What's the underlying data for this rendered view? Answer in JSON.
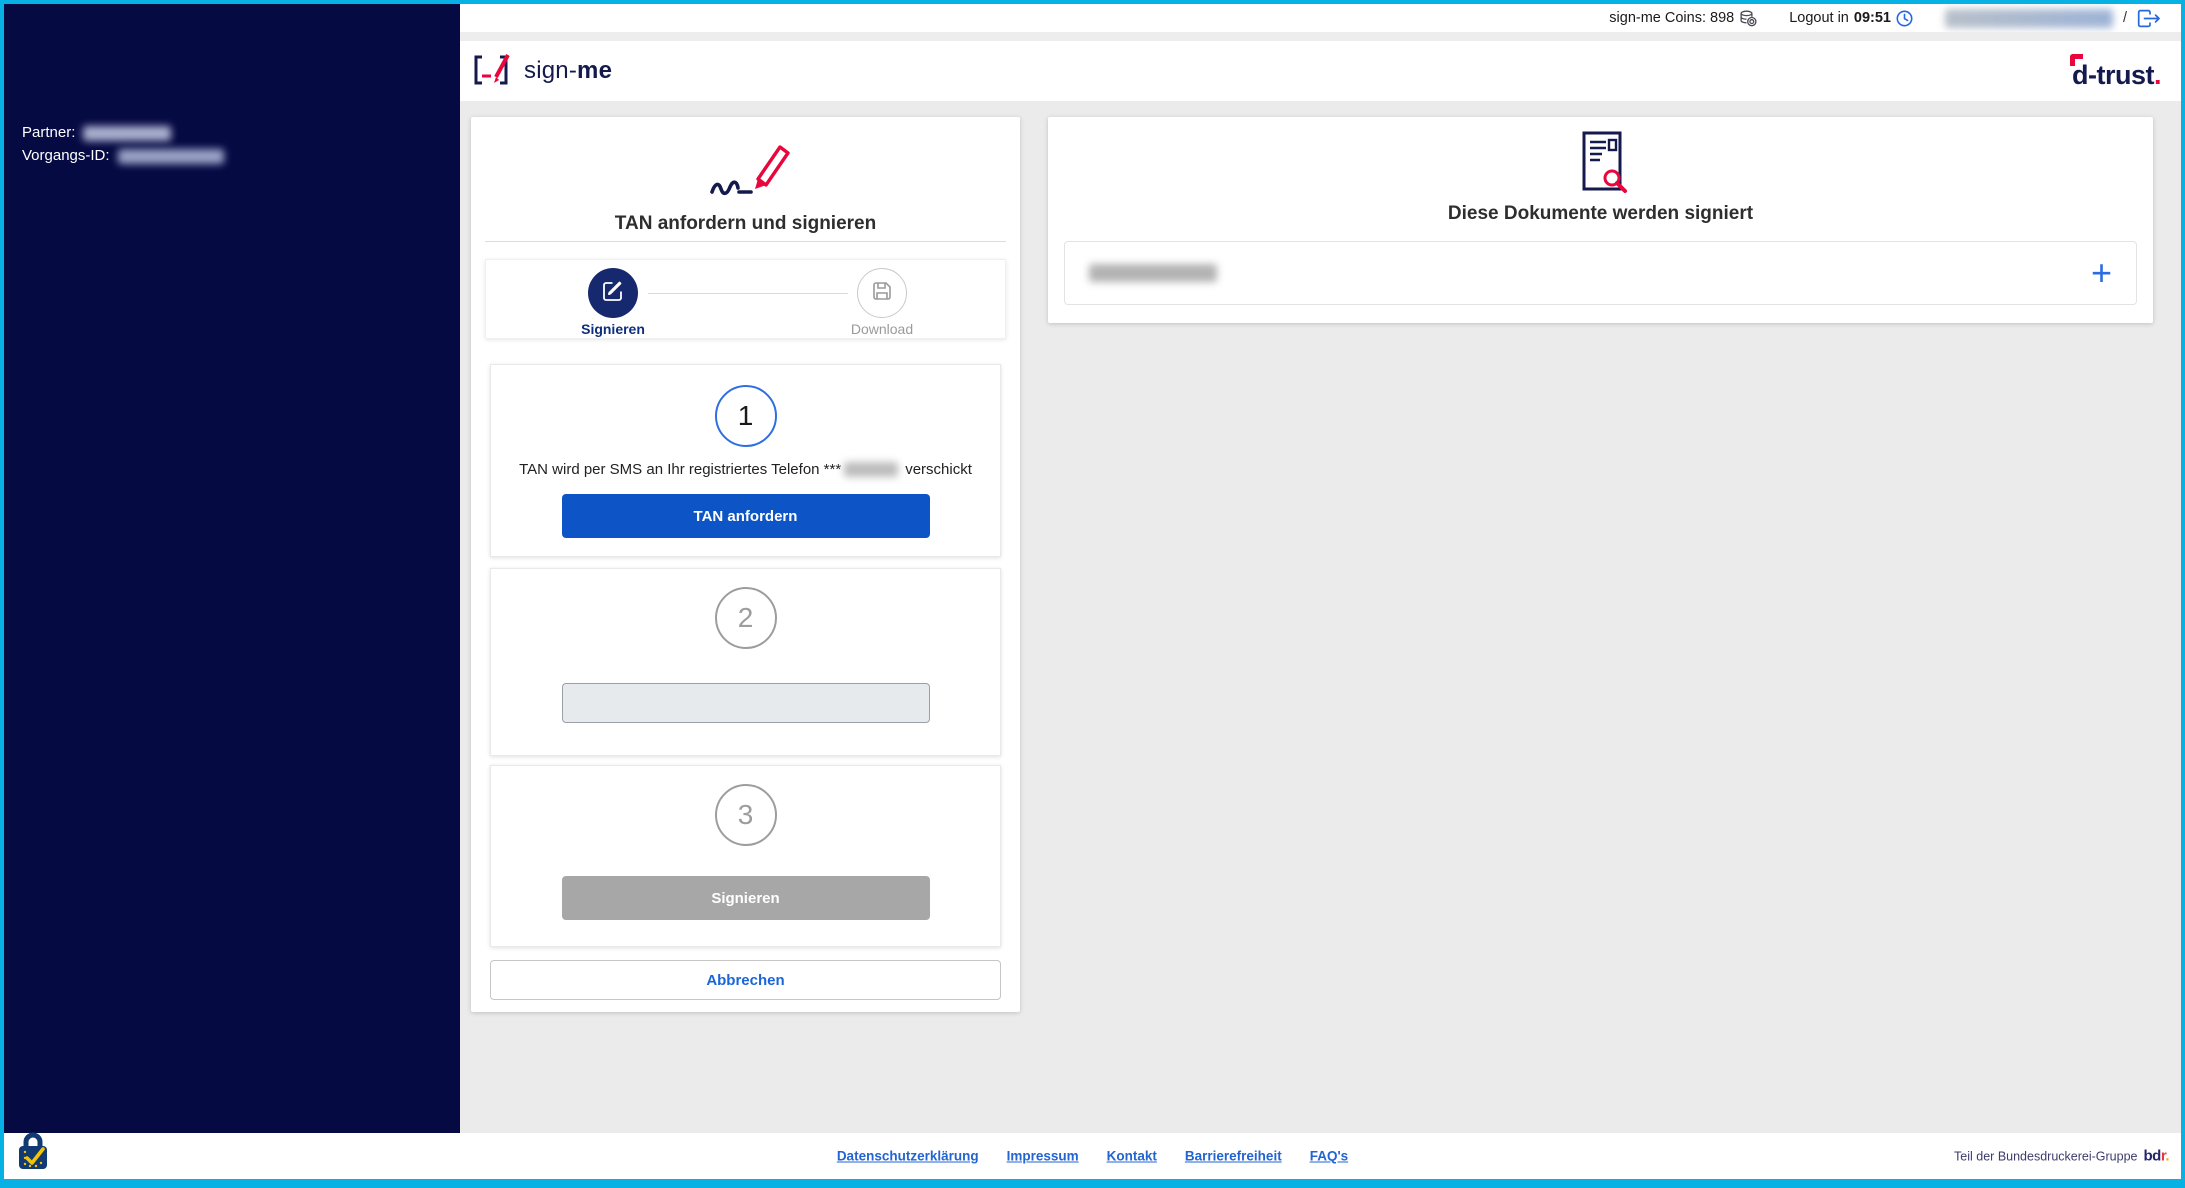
{
  "colors": {
    "border_cyan": "#07b1e3",
    "sidebar_navy": "#060a43",
    "brand_navy": "#141a4e",
    "brand_red": "#e8063c",
    "accent_blue": "#0d55c7",
    "link_blue": "#2364d2",
    "disabled_gray": "#a7a7a7"
  },
  "topbar": {
    "coins_text": "sign-me Coins: 898",
    "logout_prefix": "Logout in",
    "logout_time": "09:51",
    "separator": "/"
  },
  "header": {
    "signme_logo": {
      "part1": "sign-",
      "part2": "me"
    },
    "dtrust_logo": {
      "text": "d-trust",
      "dot": "."
    }
  },
  "sidebar": {
    "partner_label": "Partner:",
    "vorgangsid_label": "Vorgangs-ID:"
  },
  "sign_card": {
    "title": "TAN anfordern und signieren",
    "stepper": [
      {
        "label": "Signieren",
        "state": "active"
      },
      {
        "label": "Download",
        "state": "inactive"
      }
    ],
    "step1": {
      "number": "1",
      "text_before": "TAN wird per SMS an Ihr registriertes Telefon ***",
      "text_after": "verschickt",
      "button_label": "TAN anfordern"
    },
    "step2": {
      "number": "2",
      "input_value": ""
    },
    "step3": {
      "number": "3",
      "button_label": "Signieren"
    },
    "cancel_label": "Abbrechen"
  },
  "documents_card": {
    "title": "Diese Dokumente werden signiert",
    "add_label": "+"
  },
  "footer": {
    "links": [
      "Datenschutzerklärung",
      "Impressum",
      "Kontakt",
      "Barrierefreiheit",
      "FAQ's"
    ],
    "group_text": "Teil der Bundesdruckerei-Gruppe",
    "bdr_logo": {
      "part1": "bd",
      "part2": "r",
      "dot": "."
    }
  },
  "icons": {
    "coins": "coin-stack-icon",
    "clock": "clock-icon",
    "logout": "door-exit-icon",
    "signature_pen": "signature-pen-icon",
    "edit": "pen-square-icon",
    "download": "save-disk-icon",
    "document_search": "document-magnifier-icon",
    "plus": "plus-icon",
    "trust_lock": "eu-trust-lock-icon"
  }
}
